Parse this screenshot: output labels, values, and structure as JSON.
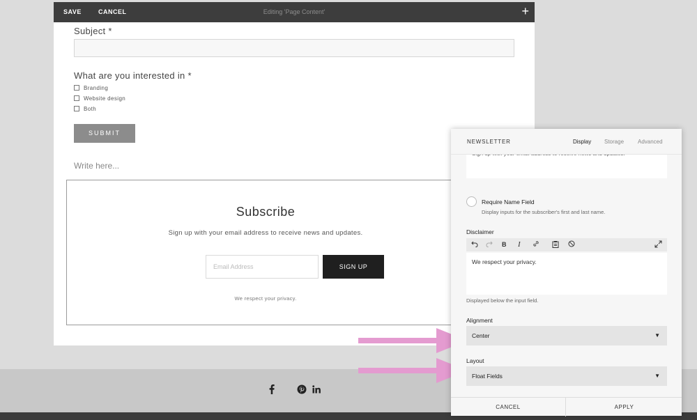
{
  "editor_bar": {
    "save_label": "SAVE",
    "cancel_label": "CANCEL",
    "title": "Editing 'Page Content'",
    "add_icon": "plus-icon"
  },
  "form": {
    "subject_label": "Subject *",
    "interest_label": "What are you interested in *",
    "options": [
      "Branding",
      "Website design",
      "Both"
    ],
    "submit_label": "SUBMIT",
    "write_placeholder": "Write here..."
  },
  "newsletter_block": {
    "title": "Subscribe",
    "description": "Sign up with your email address to receive news and updates.",
    "email_placeholder": "Email Address",
    "signup_label": "SIGN UP",
    "privacy": "We respect your privacy."
  },
  "footer": {
    "social_icons": [
      "facebook-icon",
      "pinterest-icon",
      "linkedin-icon"
    ]
  },
  "panel": {
    "title": "NEWSLETTER",
    "tabs": [
      "Display",
      "Storage",
      "Advanced"
    ],
    "active_tab": "Display",
    "description_text": "Sign up with your email address to receive news and updates.",
    "require_name_label": "Require Name Field",
    "require_name_desc": "Display inputs for the subscriber's first and last name.",
    "disclaimer_label": "Disclaimer",
    "disclaimer_text": "We respect your privacy.",
    "disclaimer_help": "Displayed below the input field.",
    "alignment_label": "Alignment",
    "alignment_value": "Center",
    "layout_label": "Layout",
    "layout_value": "Float Fields",
    "cancel_label": "CANCEL",
    "apply_label": "APPLY"
  },
  "colors": {
    "arrow": "#e49bd0",
    "toolbar": "#3d3d3d",
    "signup_button": "#1f1f1f",
    "submit_button": "#8c8c8c"
  }
}
